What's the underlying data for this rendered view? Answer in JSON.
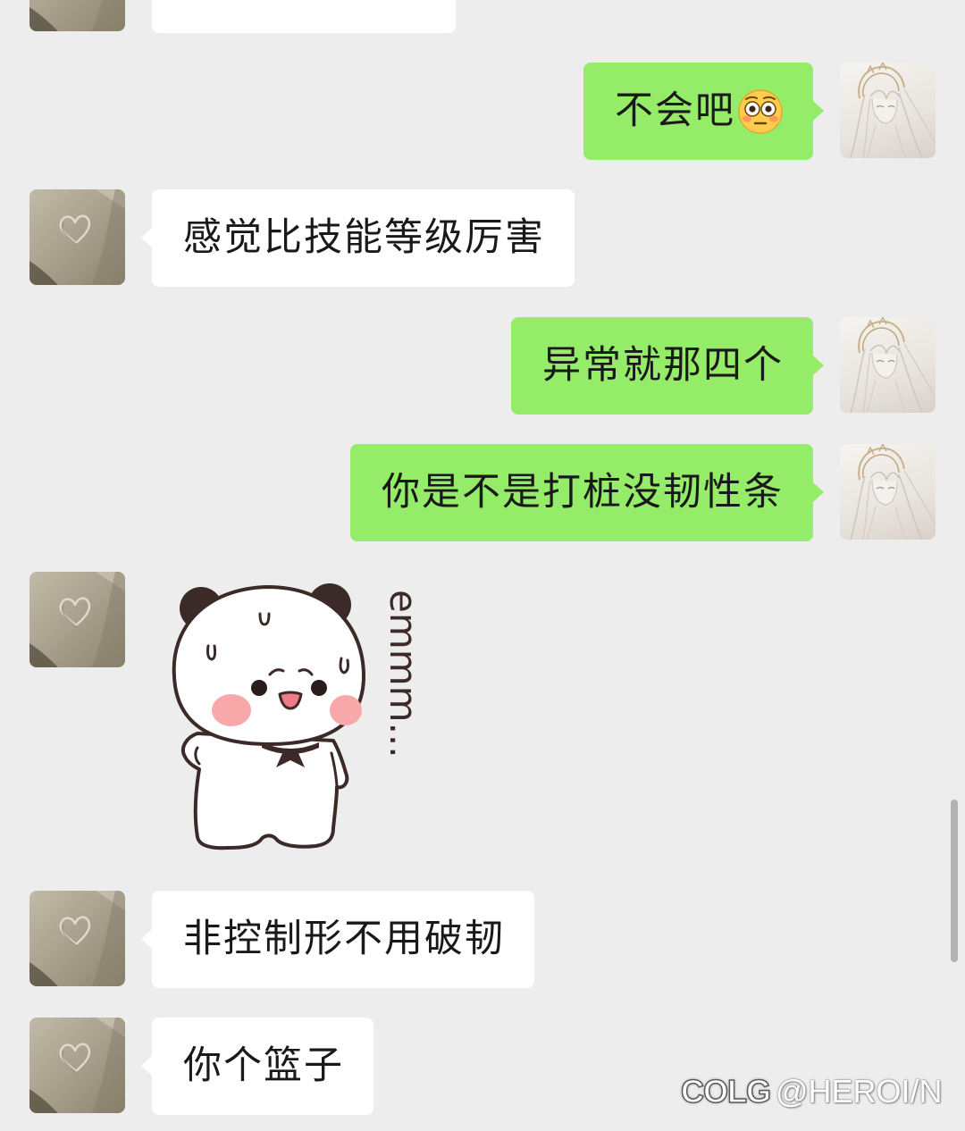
{
  "colors": {
    "background": "#ededed",
    "bubble_self": "#95ec69",
    "bubble_other": "#ffffff",
    "text": "#191919",
    "sticker_ink": "#3b2a28"
  },
  "avatars": {
    "contact_icon": "heart-sketch-photo-avatar",
    "self_icon": "anime-girl-sketch-avatar"
  },
  "chat": {
    "messages": [
      {
        "text": ""
      },
      {
        "text": "不会吧",
        "emoji_icon": "flushed-face-emoji"
      },
      {
        "text": "感觉比技能等级厉害"
      },
      {
        "text": "异常就那四个"
      },
      {
        "text": "你是不是打桩没韧性条"
      },
      {
        "sticker_icon": "sweating-panda-sticker",
        "sticker_text": "emmm..."
      },
      {
        "text": "非控制形不用破韧"
      },
      {
        "text": "你个篮子"
      }
    ]
  },
  "watermark": {
    "logo": "COLG",
    "handle": "@HEROI/N"
  }
}
